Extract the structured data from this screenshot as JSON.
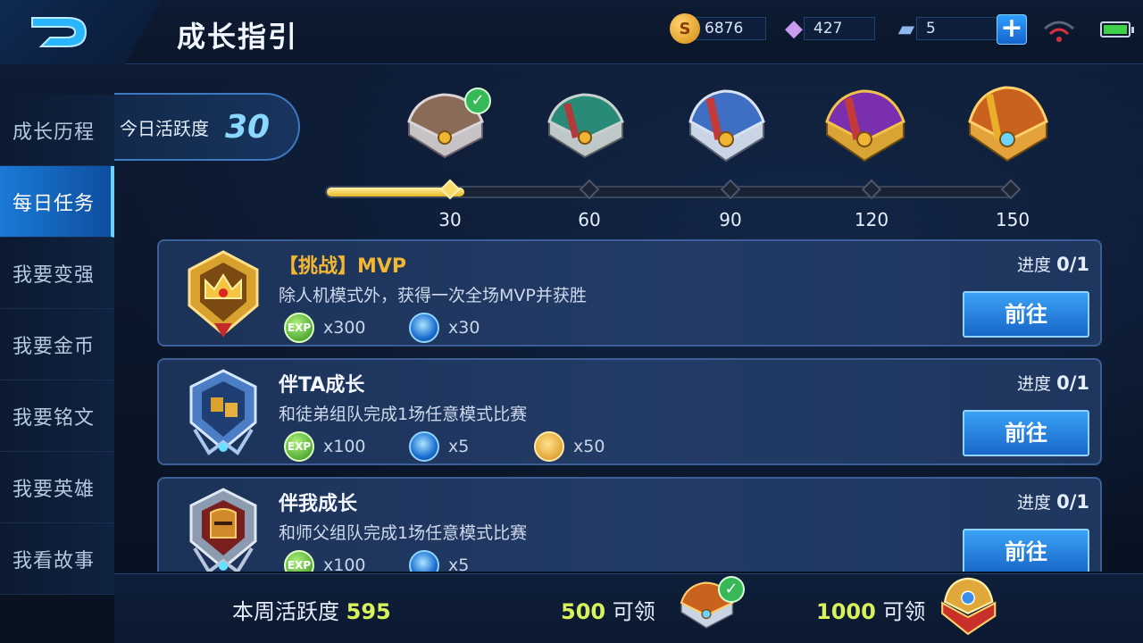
{
  "header": {
    "title": "成长指引",
    "currencies": [
      {
        "icon": "gold-coin-icon",
        "value": "6876"
      },
      {
        "icon": "diamond-icon",
        "value": "427"
      },
      {
        "icon": "voucher-card-icon",
        "value": "5"
      }
    ]
  },
  "sidebar": {
    "items": [
      {
        "label": "成长历程"
      },
      {
        "label": "每日任务",
        "active": true
      },
      {
        "label": "我要变强"
      },
      {
        "label": "我要金币"
      },
      {
        "label": "我要铭文"
      },
      {
        "label": "我要英雄"
      },
      {
        "label": "我看故事"
      }
    ]
  },
  "activity": {
    "label": "今日活跃度",
    "value": "30",
    "progress": 0.2,
    "milestones": [
      "30",
      "60",
      "90",
      "120",
      "150"
    ],
    "chests": [
      {
        "icon": "silver-chest-icon",
        "claimed": true
      },
      {
        "icon": "green-chest-icon",
        "claimed": false
      },
      {
        "icon": "blue-chest-icon",
        "claimed": false
      },
      {
        "icon": "purple-chest-icon",
        "claimed": false
      },
      {
        "icon": "gold-chest-icon",
        "claimed": false
      }
    ]
  },
  "tasks": [
    {
      "title": "【挑战】MVP",
      "description": "除人机模式外，获得一次全场MVP并获胜",
      "progress_label": "进度",
      "progress_value": "0/1",
      "button": "前往",
      "rewards": [
        {
          "icon": "exp-icon",
          "amount": "x300"
        },
        {
          "icon": "blue-orb-icon",
          "amount": "x30"
        }
      ]
    },
    {
      "title": "伴TA成长",
      "description": "和徒弟组队完成1场任意模式比赛",
      "progress_label": "进度",
      "progress_value": "0/1",
      "button": "前往",
      "rewards": [
        {
          "icon": "exp-icon",
          "amount": "x100"
        },
        {
          "icon": "blue-orb-icon",
          "amount": "x5"
        },
        {
          "icon": "gold-medal-icon",
          "amount": "x50"
        }
      ]
    },
    {
      "title": "伴我成长",
      "description": "和师父组队完成1场任意模式比赛",
      "progress_label": "进度",
      "progress_value": "0/1",
      "button": "前往",
      "rewards": [
        {
          "icon": "exp-icon",
          "amount": "x100"
        },
        {
          "icon": "blue-orb-icon",
          "amount": "x5"
        }
      ]
    }
  ],
  "weekly": {
    "label": "本周活跃度",
    "value": "595",
    "rewards": [
      {
        "threshold": "500",
        "suffix": "可领",
        "claimed": true
      },
      {
        "threshold": "1000",
        "suffix": "可领",
        "claimed": false
      }
    ]
  },
  "colors": {
    "accent_blue": "#1a7ad6",
    "highlight_yellow": "#d8f25a",
    "title_gold": "#f5b731"
  }
}
